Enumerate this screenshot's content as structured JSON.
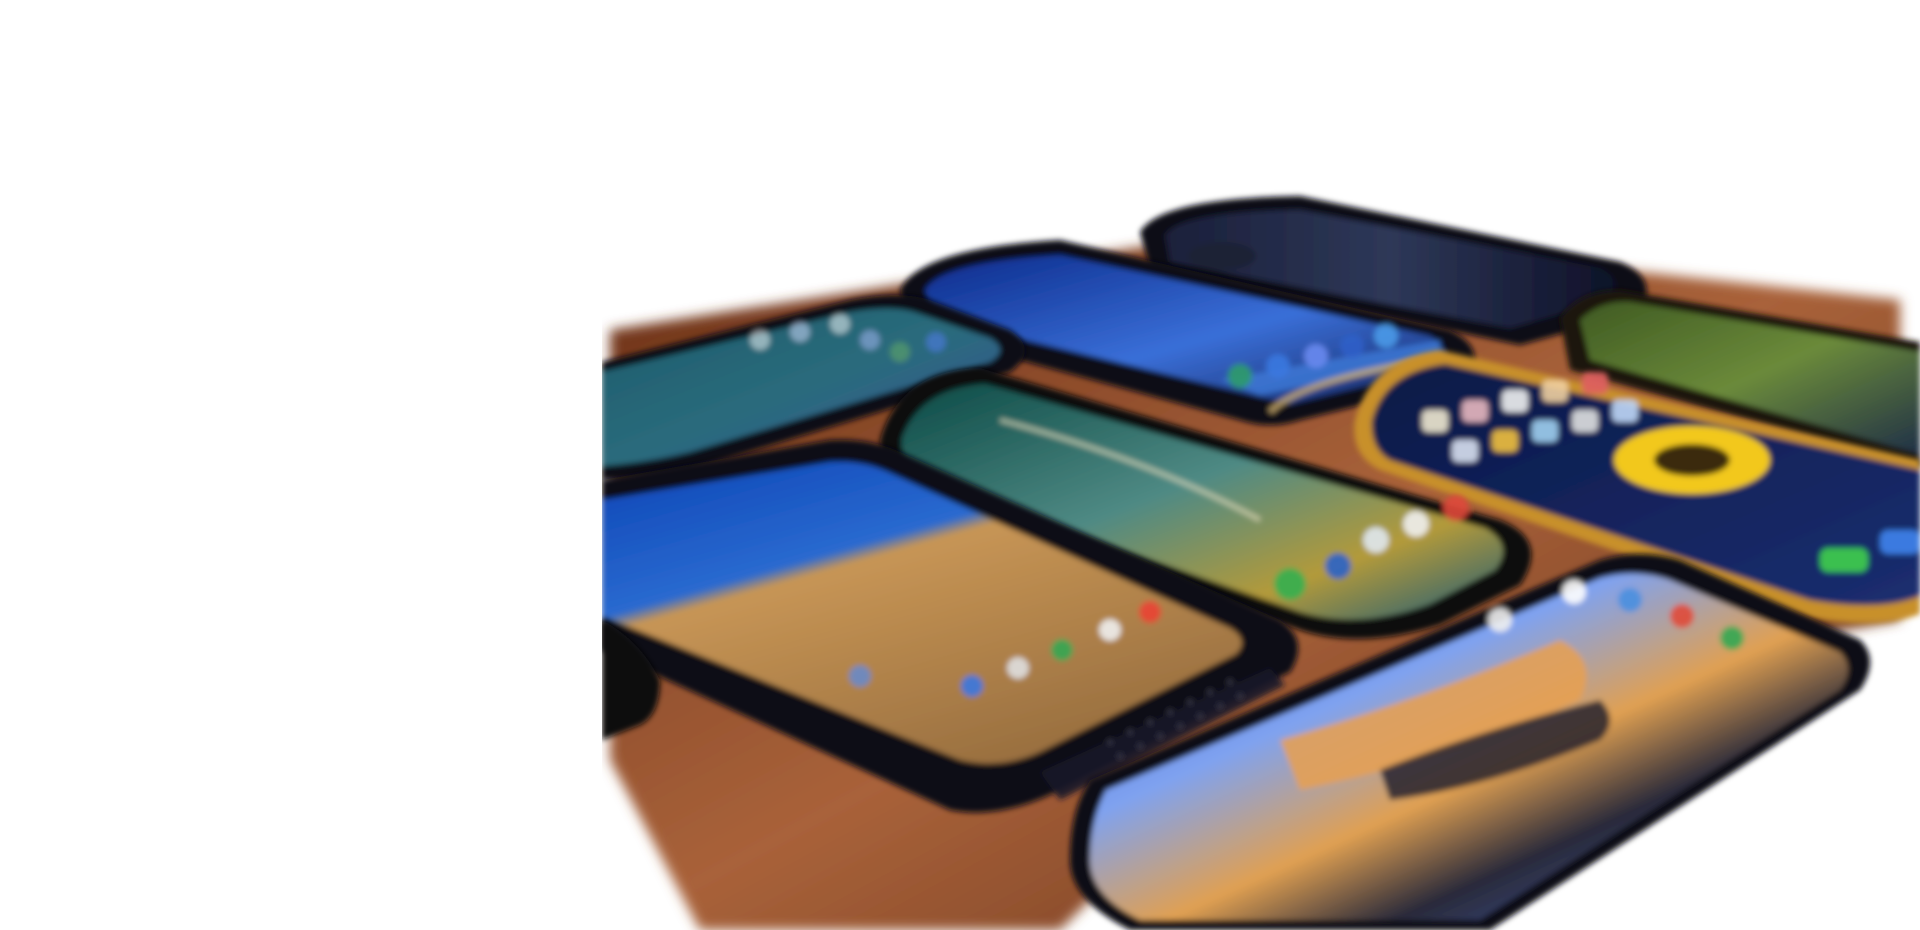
{
  "image": {
    "subject": "phones-on-table",
    "background_color": "#ffffff",
    "table_color": "#8a4a2a",
    "phone_count": 10,
    "phones": [
      {
        "name": "phone-top-left",
        "screen_colors": [
          "#0f3a4a",
          "#2a6b7c",
          "#3b4f9a"
        ]
      },
      {
        "name": "phone-top-center",
        "screen_colors": [
          "#0c2d8a",
          "#3a6fd8",
          "#1b2a6a"
        ]
      },
      {
        "name": "phone-top-right",
        "screen_colors": [
          "#0e0f2a",
          "#2b3350",
          "#11152e"
        ]
      },
      {
        "name": "phone-far-right",
        "screen_colors": [
          "#2a3f1c",
          "#6b8a3a",
          "#203045"
        ]
      },
      {
        "name": "phone-blackberry",
        "screen_colors": [
          "#0b3fa8",
          "#c99a5a",
          "#8a6a3a"
        ]
      },
      {
        "name": "phone-center-wave",
        "screen_colors": [
          "#0e4a46",
          "#5b8f8a",
          "#c9a03a"
        ]
      },
      {
        "name": "phone-iphone-xr",
        "screen_colors": [
          "#0b1a4a",
          "#f2c81a",
          "#1a2b6a"
        ]
      },
      {
        "name": "phone-oneplus",
        "screen_colors": [
          "#3a5fd8",
          "#e09a4a",
          "#1a1a2a"
        ]
      },
      {
        "name": "phone-edge-left",
        "screen_colors": [
          "#0a0a0a"
        ]
      }
    ]
  }
}
